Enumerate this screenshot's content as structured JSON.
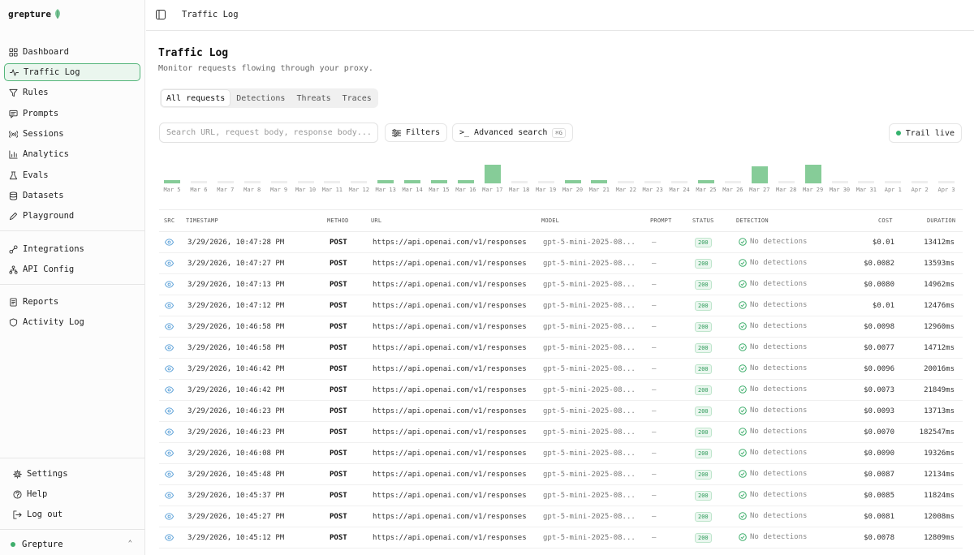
{
  "app": {
    "name": "grepture",
    "workspace": "Grepture"
  },
  "colors": {
    "accent": "#3fae6c",
    "badge": "#2f9a5a"
  },
  "sidebar": {
    "items": [
      {
        "label": "Dashboard",
        "icon": "grid-icon"
      },
      {
        "label": "Traffic Log",
        "icon": "activity-icon",
        "active": true
      },
      {
        "label": "Rules",
        "icon": "filter-icon"
      },
      {
        "label": "Prompts",
        "icon": "message-icon"
      },
      {
        "label": "Sessions",
        "icon": "broadcast-icon"
      },
      {
        "label": "Analytics",
        "icon": "chart-icon"
      },
      {
        "label": "Evals",
        "icon": "flask-icon"
      },
      {
        "label": "Datasets",
        "icon": "database-icon"
      },
      {
        "label": "Playground",
        "icon": "pen-icon"
      },
      {
        "label": "Integrations",
        "icon": "plug-icon"
      },
      {
        "label": "API Config",
        "icon": "network-icon"
      },
      {
        "label": "Reports",
        "icon": "report-icon"
      },
      {
        "label": "Activity Log",
        "icon": "shield-icon"
      }
    ],
    "footer": [
      {
        "label": "Settings",
        "icon": "gear-icon"
      },
      {
        "label": "Help",
        "icon": "help-icon"
      },
      {
        "label": "Log out",
        "icon": "logout-icon"
      }
    ]
  },
  "header": {
    "breadcrumb": "Traffic Log"
  },
  "main": {
    "title": "Traffic Log",
    "subtitle": "Monitor requests flowing through your proxy.",
    "tabs": [
      "All requests",
      "Detections",
      "Threats",
      "Traces"
    ],
    "search_placeholder": "Search URL, request body, response body...",
    "filters_label": "Filters",
    "advanced_label": "Advanced search",
    "advanced_shortcut": "⌘G",
    "live_label": "Trail live"
  },
  "histogram": {
    "labels": [
      "Mar 5",
      "Mar 6",
      "Mar 7",
      "Mar 8",
      "Mar 9",
      "Mar 10",
      "Mar 11",
      "Mar 12",
      "Mar 13",
      "Mar 14",
      "Mar 15",
      "Mar 16",
      "Mar 17",
      "Mar 18",
      "Mar 19",
      "Mar 20",
      "Mar 21",
      "Mar 22",
      "Mar 23",
      "Mar 24",
      "Mar 25",
      "Mar 26",
      "Mar 27",
      "Mar 28",
      "Mar 29",
      "Mar 30",
      "Mar 31",
      "Apr 1",
      "Apr 2",
      "Apr 3"
    ],
    "levels": [
      0.18,
      0.1,
      0.1,
      0.1,
      0.1,
      0.1,
      0.1,
      0.1,
      0.18,
      0.18,
      0.18,
      0.18,
      1.0,
      0.1,
      0.1,
      0.18,
      0.18,
      0.1,
      0.1,
      0.1,
      0.18,
      0.1,
      0.9,
      0.1,
      1.0,
      0.1,
      0.1,
      0.1,
      0.1,
      0.1
    ],
    "active": [
      true,
      false,
      false,
      false,
      false,
      false,
      false,
      false,
      true,
      true,
      true,
      true,
      true,
      false,
      false,
      true,
      true,
      false,
      false,
      false,
      true,
      false,
      true,
      false,
      true,
      false,
      false,
      false,
      false,
      false
    ]
  },
  "table": {
    "headers": {
      "src": "SRC",
      "timestamp": "TIMESTAMP",
      "method": "METHOD",
      "url": "URL",
      "model": "MODEL",
      "prompt": "PROMPT",
      "status": "STATUS",
      "detection": "DETECTION",
      "cost": "COST",
      "duration": "DURATION"
    },
    "rows": [
      {
        "timestamp": "3/29/2026, 10:47:28 PM",
        "method": "POST",
        "url": "https://api.openai.com/v1/responses",
        "model": "gpt-5-mini-2025-08...",
        "prompt": "—",
        "status": "200",
        "detection": "No detections",
        "cost": "$0.01",
        "duration": "13412ms"
      },
      {
        "timestamp": "3/29/2026, 10:47:27 PM",
        "method": "POST",
        "url": "https://api.openai.com/v1/responses",
        "model": "gpt-5-mini-2025-08...",
        "prompt": "—",
        "status": "200",
        "detection": "No detections",
        "cost": "$0.0082",
        "duration": "13593ms"
      },
      {
        "timestamp": "3/29/2026, 10:47:13 PM",
        "method": "POST",
        "url": "https://api.openai.com/v1/responses",
        "model": "gpt-5-mini-2025-08...",
        "prompt": "—",
        "status": "200",
        "detection": "No detections",
        "cost": "$0.0080",
        "duration": "14962ms"
      },
      {
        "timestamp": "3/29/2026, 10:47:12 PM",
        "method": "POST",
        "url": "https://api.openai.com/v1/responses",
        "model": "gpt-5-mini-2025-08...",
        "prompt": "—",
        "status": "200",
        "detection": "No detections",
        "cost": "$0.01",
        "duration": "12476ms"
      },
      {
        "timestamp": "3/29/2026, 10:46:58 PM",
        "method": "POST",
        "url": "https://api.openai.com/v1/responses",
        "model": "gpt-5-mini-2025-08...",
        "prompt": "—",
        "status": "200",
        "detection": "No detections",
        "cost": "$0.0098",
        "duration": "12960ms"
      },
      {
        "timestamp": "3/29/2026, 10:46:58 PM",
        "method": "POST",
        "url": "https://api.openai.com/v1/responses",
        "model": "gpt-5-mini-2025-08...",
        "prompt": "—",
        "status": "200",
        "detection": "No detections",
        "cost": "$0.0077",
        "duration": "14712ms"
      },
      {
        "timestamp": "3/29/2026, 10:46:42 PM",
        "method": "POST",
        "url": "https://api.openai.com/v1/responses",
        "model": "gpt-5-mini-2025-08...",
        "prompt": "—",
        "status": "200",
        "detection": "No detections",
        "cost": "$0.0096",
        "duration": "20016ms"
      },
      {
        "timestamp": "3/29/2026, 10:46:42 PM",
        "method": "POST",
        "url": "https://api.openai.com/v1/responses",
        "model": "gpt-5-mini-2025-08...",
        "prompt": "—",
        "status": "200",
        "detection": "No detections",
        "cost": "$0.0073",
        "duration": "21849ms"
      },
      {
        "timestamp": "3/29/2026, 10:46:23 PM",
        "method": "POST",
        "url": "https://api.openai.com/v1/responses",
        "model": "gpt-5-mini-2025-08...",
        "prompt": "—",
        "status": "200",
        "detection": "No detections",
        "cost": "$0.0093",
        "duration": "13713ms"
      },
      {
        "timestamp": "3/29/2026, 10:46:23 PM",
        "method": "POST",
        "url": "https://api.openai.com/v1/responses",
        "model": "gpt-5-mini-2025-08...",
        "prompt": "—",
        "status": "200",
        "detection": "No detections",
        "cost": "$0.0070",
        "duration": "182547ms"
      },
      {
        "timestamp": "3/29/2026, 10:46:08 PM",
        "method": "POST",
        "url": "https://api.openai.com/v1/responses",
        "model": "gpt-5-mini-2025-08...",
        "prompt": "—",
        "status": "200",
        "detection": "No detections",
        "cost": "$0.0090",
        "duration": "19326ms"
      },
      {
        "timestamp": "3/29/2026, 10:45:48 PM",
        "method": "POST",
        "url": "https://api.openai.com/v1/responses",
        "model": "gpt-5-mini-2025-08...",
        "prompt": "—",
        "status": "200",
        "detection": "No detections",
        "cost": "$0.0087",
        "duration": "12134ms"
      },
      {
        "timestamp": "3/29/2026, 10:45:37 PM",
        "method": "POST",
        "url": "https://api.openai.com/v1/responses",
        "model": "gpt-5-mini-2025-08...",
        "prompt": "—",
        "status": "200",
        "detection": "No detections",
        "cost": "$0.0085",
        "duration": "11824ms"
      },
      {
        "timestamp": "3/29/2026, 10:45:27 PM",
        "method": "POST",
        "url": "https://api.openai.com/v1/responses",
        "model": "gpt-5-mini-2025-08...",
        "prompt": "—",
        "status": "200",
        "detection": "No detections",
        "cost": "$0.0081",
        "duration": "12008ms"
      },
      {
        "timestamp": "3/29/2026, 10:45:12 PM",
        "method": "POST",
        "url": "https://api.openai.com/v1/responses",
        "model": "gpt-5-mini-2025-08...",
        "prompt": "—",
        "status": "200",
        "detection": "No detections",
        "cost": "$0.0078",
        "duration": "12809ms"
      }
    ]
  }
}
